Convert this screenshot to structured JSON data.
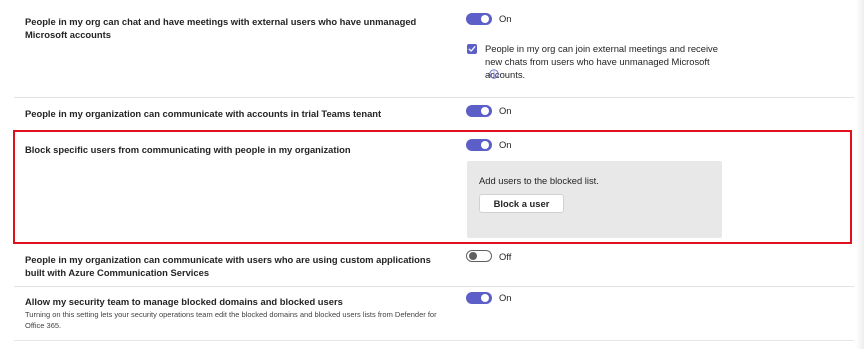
{
  "settings": [
    {
      "label": "People in my org can chat and have meetings with external users who have unmanaged Microsoft accounts",
      "toggle_state": "On",
      "checkbox_label": "People in my org can join external meetings and receive new chats from users who have unmanaged Microsoft accounts.",
      "checkbox_checked": true,
      "info_icon": "info-icon"
    },
    {
      "label": "People in my organization can communicate with accounts in trial Teams tenant",
      "toggle_state": "On"
    },
    {
      "label": "Block specific users from communicating with people in my organization",
      "toggle_state": "On",
      "panel_text": "Add users to the blocked list.",
      "button_label": "Block a user"
    },
    {
      "label": "People in my organization can communicate with users who are using custom applications built with Azure Communication Services",
      "toggle_state": "Off"
    },
    {
      "label": "Allow my security team to manage blocked domains and blocked users",
      "description": "Turning on this setting lets your security operations team edit the blocked domains and blocked users lists from Defender for Office 365.",
      "toggle_state": "On"
    }
  ],
  "colors": {
    "accent": "#5b5fc7",
    "highlight": "#e0101e",
    "panel": "#e8e8e8"
  }
}
